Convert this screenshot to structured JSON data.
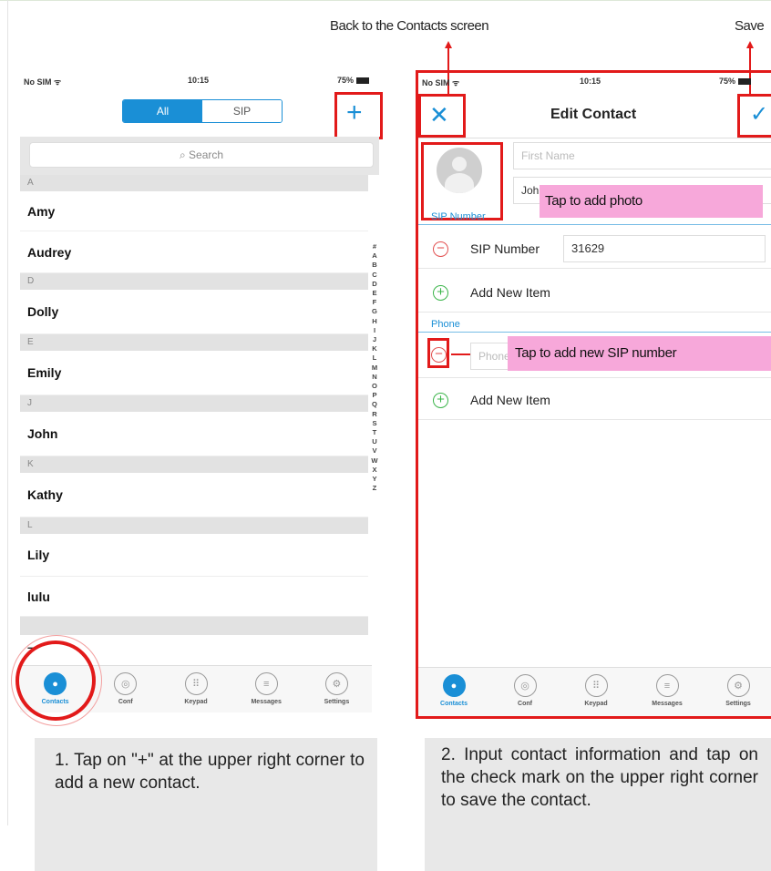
{
  "annotations": {
    "back": "Back to the Contacts screen",
    "save": "Save",
    "tap_photo": "Tap to add photo",
    "tap_sip": "Tap to add new SIP number"
  },
  "phone1": {
    "status": {
      "carrier": "No SIM",
      "time": "10:15",
      "battery": "75%"
    },
    "segment": {
      "all": "All",
      "sip": "SIP"
    },
    "add_icon": "+",
    "search_placeholder": "Search",
    "sections": [
      {
        "letter": "A",
        "names": [
          "Amy",
          "Audrey"
        ]
      },
      {
        "letter": "D",
        "names": [
          "Dolly"
        ]
      },
      {
        "letter": "E",
        "names": [
          "Emily"
        ]
      },
      {
        "letter": "J",
        "names": [
          "John"
        ]
      },
      {
        "letter": "K",
        "names": [
          "Kathy"
        ]
      },
      {
        "letter": "L",
        "names": [
          "Lily",
          "lulu"
        ]
      }
    ],
    "index_letters": [
      "#",
      "A",
      "B",
      "C",
      "D",
      "E",
      "F",
      "G",
      "H",
      "I",
      "J",
      "K",
      "L",
      "M",
      "N",
      "O",
      "P",
      "Q",
      "R",
      "S",
      "T",
      "U",
      "V",
      "W",
      "X",
      "Y",
      "Z"
    ]
  },
  "phone2": {
    "status": {
      "carrier": "No SIM",
      "time": "10:15",
      "battery": "75%"
    },
    "title": "Edit Contact",
    "first_name_placeholder": "First Name",
    "last_name_value": "John",
    "sip_section": "SIP Number",
    "sip_label": "SIP Number",
    "sip_value": "31629",
    "add_new_item": "Add New Item",
    "phone_section": "Phone",
    "phone_placeholder": "Phone"
  },
  "tabs": [
    {
      "label": "Contacts",
      "icon": "person-icon",
      "glyph": "●"
    },
    {
      "label": "Conf",
      "icon": "conference-icon",
      "glyph": "◎"
    },
    {
      "label": "Keypad",
      "icon": "keypad-icon",
      "glyph": "⠿"
    },
    {
      "label": "Messages",
      "icon": "messages-icon",
      "glyph": "≡"
    },
    {
      "label": "Settings",
      "icon": "gear-icon",
      "glyph": "⚙"
    }
  ],
  "captions": {
    "step1": "1. Tap on \"+\" at the upper right corner to add a new contact.",
    "step2": "2. Input contact information and tap on the check mark on the upper right corner to save the contact."
  },
  "colors": {
    "accent": "#1a8fd6",
    "highlight_red": "#e21a1a",
    "callout_pink": "#f7a8da"
  }
}
